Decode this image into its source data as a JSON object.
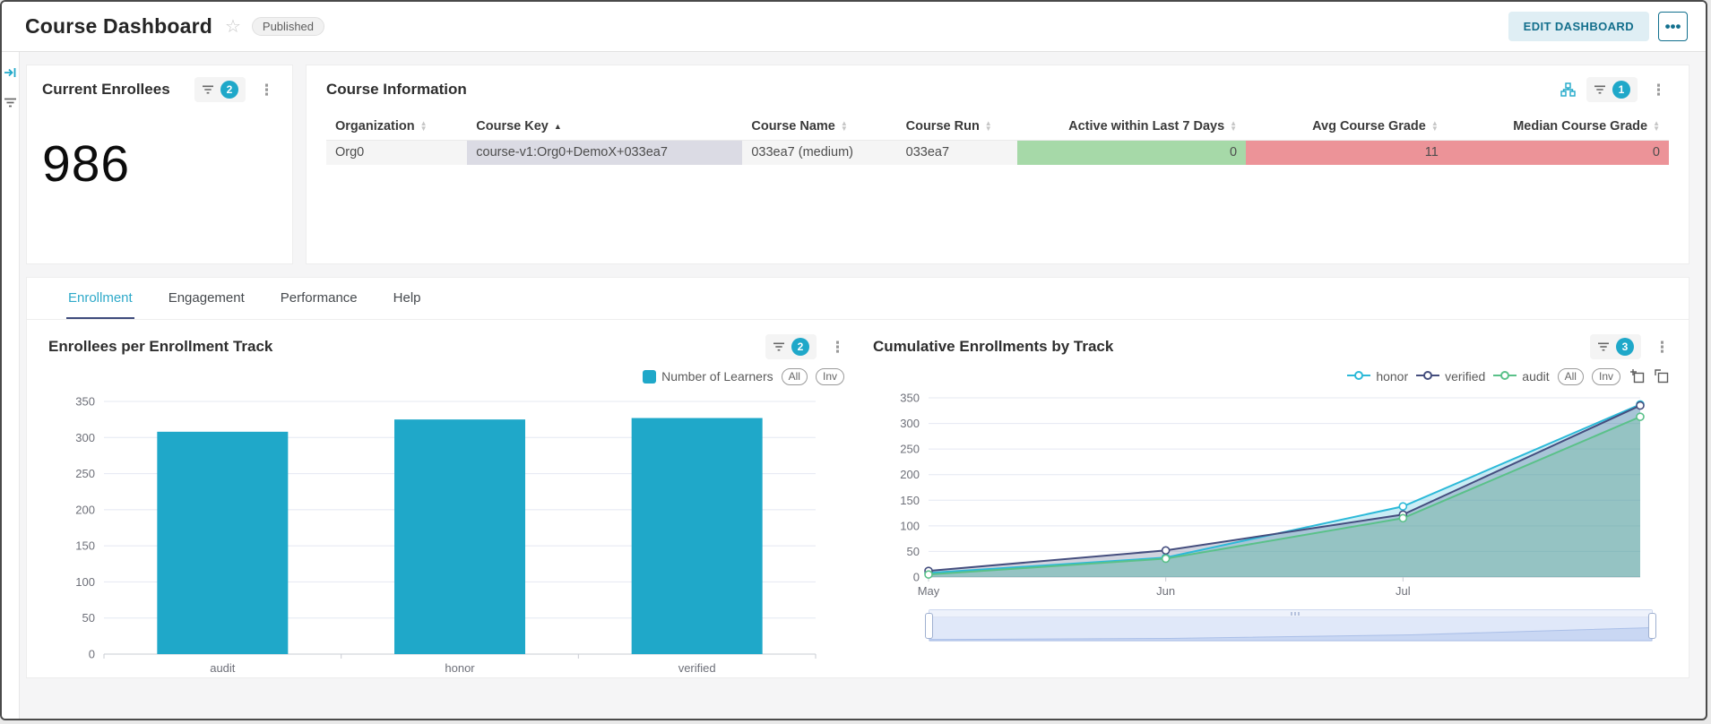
{
  "header": {
    "title": "Course Dashboard",
    "status_badge": "Published",
    "edit_button": "EDIT DASHBOARD"
  },
  "colors": {
    "accent": "#1fa8c9",
    "honor": "#2cb9d8",
    "verified": "#454e7e",
    "audit": "#5ac189",
    "cell_green": "#a6d9a8",
    "cell_red": "#ec9398",
    "active_tab": "#2ea9c9",
    "tab_underline": "#3f4b7c"
  },
  "current_enrollees": {
    "title": "Current Enrollees",
    "filter_count": "2",
    "value": "986"
  },
  "course_information": {
    "title": "Course Information",
    "filter_count": "1",
    "columns": [
      "Organization",
      "Course Key",
      "Course Name",
      "Course Run",
      "Active within Last 7 Days",
      "Avg Course Grade",
      "Median Course Grade"
    ],
    "sorted_column": "Course Key",
    "row": {
      "organization": "Org0",
      "course_key": "course-v1:Org0+DemoX+033ea7",
      "course_name": "033ea7 (medium)",
      "course_run": "033ea7",
      "active_within_last_7_days": "0",
      "avg_course_grade": "11",
      "median_course_grade": "0"
    }
  },
  "tabs": {
    "items": [
      "Enrollment",
      "Engagement",
      "Performance",
      "Help"
    ],
    "active": "Enrollment"
  },
  "chart_data": [
    {
      "type": "bar",
      "title": "Enrollees per Enrollment Track",
      "filter_count": "2",
      "legend": "Number of Learners",
      "legend_pills": [
        "All",
        "Inv"
      ],
      "categories": [
        "audit",
        "honor",
        "verified"
      ],
      "values": [
        308,
        325,
        327
      ],
      "color": "#1fa8c9",
      "xlabel": "",
      "ylabel": "",
      "ylim": [
        0,
        350
      ],
      "yticks": [
        0,
        50,
        100,
        150,
        200,
        250,
        300,
        350
      ],
      "grid": true,
      "legend_position": "top-right"
    },
    {
      "type": "line",
      "title": "Cumulative Enrollments by Track",
      "filter_count": "3",
      "legend_pills": [
        "All",
        "Inv"
      ],
      "x": [
        "May",
        "Jun",
        "Jul",
        ""
      ],
      "series": [
        {
          "name": "honor",
          "color": "#2cb9d8",
          "values": [
            8,
            38,
            138,
            337
          ]
        },
        {
          "name": "verified",
          "color": "#454e7e",
          "values": [
            12,
            52,
            122,
            335
          ]
        },
        {
          "name": "audit",
          "color": "#5ac189",
          "values": [
            5,
            36,
            115,
            313
          ]
        }
      ],
      "xlabel": "",
      "ylabel": "",
      "ylim": [
        0,
        350
      ],
      "yticks": [
        0,
        50,
        100,
        150,
        200,
        250,
        300,
        350
      ],
      "grid": true,
      "area_opacity": 0.25,
      "legend_position": "top-right",
      "has_range_slider": true
    }
  ]
}
